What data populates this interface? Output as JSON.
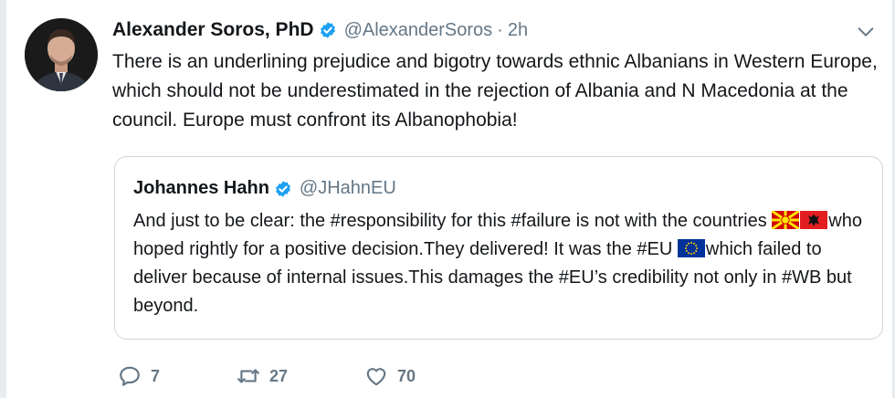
{
  "tweet": {
    "author_name": "Alexander Soros, PhD",
    "handle": "@AlexanderSoros",
    "separator": "·",
    "time": "2h",
    "text": "There is an underlining prejudice and bigotry towards ethnic Albanians in Western Europe, which should not be underestimated in the rejection of Albania and N Macedonia at the council. Europe must confront its Albanophobia!"
  },
  "quote": {
    "author_name": "Johannes Hahn",
    "handle": "@JHahnEU",
    "text_part1": "And just to be clear: the #responsibility for this #failure is not with the countries ",
    "text_part2": "who hoped rightly for a positive decision.They delivered! It was the #EU ",
    "text_part3": "which failed to deliver because of internal issues.This damages the #EU’s credibility not only in #WB but beyond.",
    "flags": [
      "north-macedonia-flag",
      "albania-flag",
      "eu-flag"
    ]
  },
  "actions": {
    "replies": "7",
    "retweets": "27",
    "likes": "70"
  },
  "icons": [
    "verified-badge-icon",
    "chevron-down-icon",
    "reply-icon",
    "retweet-icon",
    "like-icon"
  ],
  "colors": {
    "verified": "#1da1f2",
    "secondary_text": "#657786",
    "border": "#ccd6dd"
  }
}
